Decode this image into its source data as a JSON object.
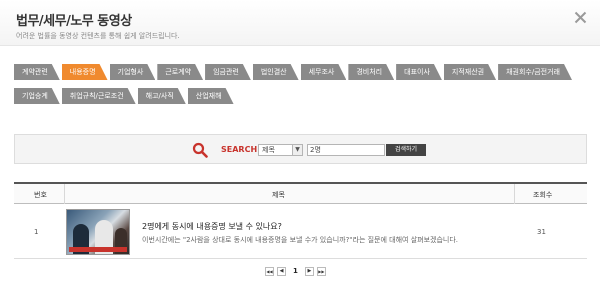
{
  "header": {
    "title": "법무/세무/노무 동영상",
    "subtitle": "어려운 법률을 동영상 컨텐츠를 통해 쉽게 알려드립니다."
  },
  "tabs_row1": [
    {
      "label": "계약관련",
      "active": false
    },
    {
      "label": "내용증명",
      "active": true
    },
    {
      "label": "기업형사",
      "active": false
    },
    {
      "label": "근로계약",
      "active": false
    },
    {
      "label": "임금관련",
      "active": false
    },
    {
      "label": "법인결산",
      "active": false
    },
    {
      "label": "세무조사",
      "active": false
    },
    {
      "label": "경비처리",
      "active": false
    },
    {
      "label": "대표이사",
      "active": false
    },
    {
      "label": "지적재산권",
      "active": false
    },
    {
      "label": "채권회수/금전거래",
      "active": false
    }
  ],
  "tabs_row2": [
    {
      "label": "기업승계",
      "active": false
    },
    {
      "label": "취업규칙/근로조건",
      "active": false
    },
    {
      "label": "해고/사직",
      "active": false
    },
    {
      "label": "산업재해",
      "active": false
    }
  ],
  "search": {
    "label": "SEARCH",
    "field_selected": "제목",
    "query": "2명",
    "button_label": "검색하기"
  },
  "table": {
    "headers": {
      "num": "번호",
      "title": "제목",
      "views": "조회수"
    },
    "rows": [
      {
        "num": "1",
        "title": "2명에게 동시에 내용증명 보낼 수 있나요?",
        "desc": "이번시간에는 \"2사람을 상대로 동시에 내용증명을 보낼 수가 있습니까?\"라는 질문에 대해여 살펴보겠습니다.",
        "views": "31"
      }
    ]
  },
  "pagination": {
    "current": "1",
    "first": "◀◀",
    "prev": "◀",
    "next": "▶",
    "last": "▶▶"
  },
  "colors": {
    "active_tab": "#f08a2e",
    "inactive_tab": "#8a8a8a",
    "search_accent": "#c8332c"
  }
}
